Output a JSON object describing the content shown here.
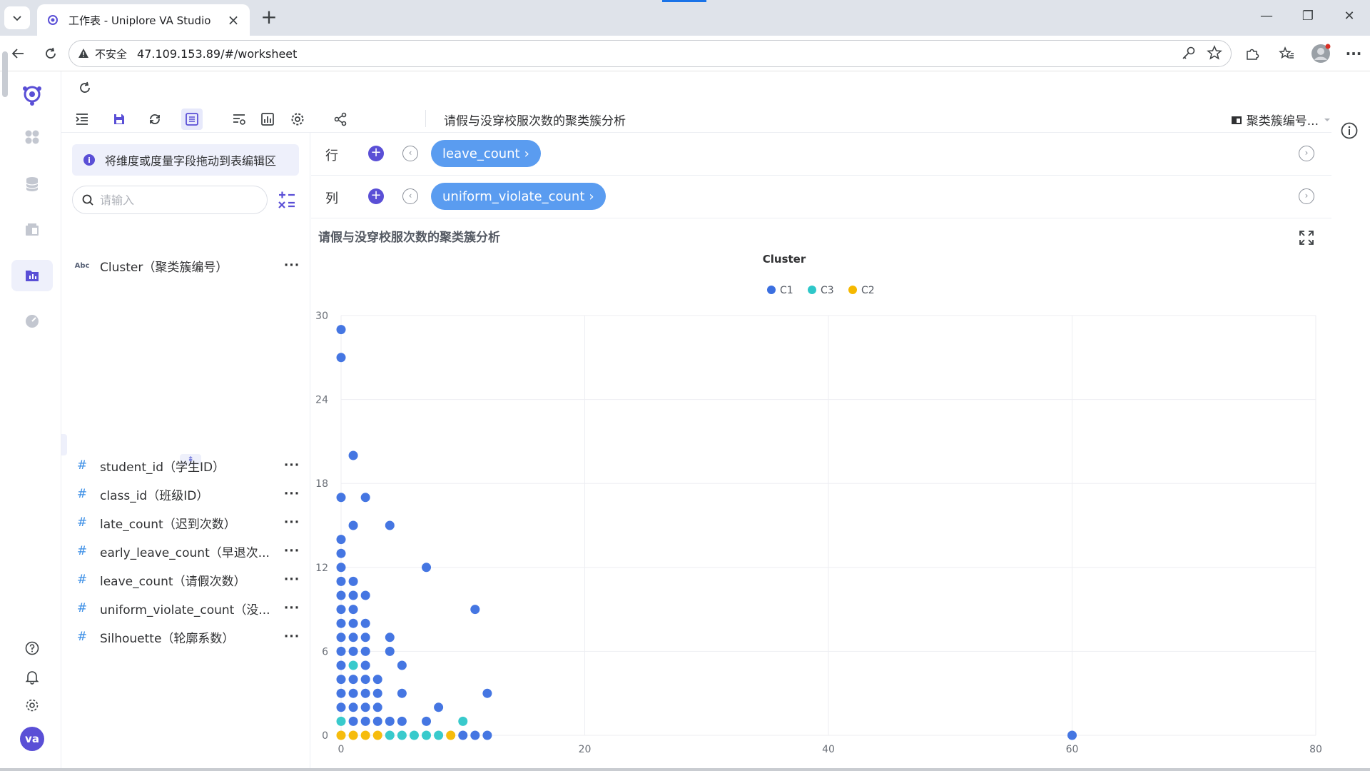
{
  "browser": {
    "tab_title": "工作表 - Uniplore VA Studio",
    "insecure_label": "不安全",
    "url": "47.109.153.89/#/worksheet"
  },
  "worksheet": {
    "title": "请假与没穿校服次数的聚类簇分析",
    "right_label": "聚类簇编号..."
  },
  "field_panel": {
    "hint": "将维度或度量字段拖动到表编辑区",
    "search_placeholder": "请输入",
    "dimension_icon": "Abc",
    "measure_icon": "#",
    "more_icon": "···",
    "dimensions": [
      {
        "label": "Cluster（聚类簇编号）"
      }
    ],
    "measures": [
      {
        "label": "student_id（学生ID）"
      },
      {
        "label": "class_id（班级ID）"
      },
      {
        "label": "late_count（迟到次数）"
      },
      {
        "label": "early_leave_count（早退次..."
      },
      {
        "label": "leave_count（请假次数）"
      },
      {
        "label": "uniform_violate_count（没..."
      },
      {
        "label": "Silhouette（轮廓系数）"
      }
    ]
  },
  "shelves": {
    "row_label": "行",
    "col_label": "列",
    "row_pill": "leave_count",
    "col_pill": "uniform_violate_count"
  },
  "colors": {
    "accent": "#5a4fd6",
    "pill": "#5a9cf0",
    "C1": "#3b6fe0",
    "C3": "#2ec7c9",
    "C2": "#f5b800"
  },
  "chart_data": {
    "type": "scatter",
    "title": "请假与没穿校服次数的聚类簇分析",
    "legend_title": "Cluster",
    "legend_position": "top-center",
    "xlim": [
      0,
      80
    ],
    "ylim": [
      0,
      30
    ],
    "x_ticks": [
      0,
      20,
      40,
      60,
      80
    ],
    "y_ticks": [
      0,
      6,
      12,
      18,
      24,
      30
    ],
    "grid": true,
    "series": [
      {
        "name": "C1",
        "color": "#3b6fe0",
        "points": [
          [
            0,
            29
          ],
          [
            0,
            27
          ],
          [
            1,
            20
          ],
          [
            0,
            17
          ],
          [
            2,
            17
          ],
          [
            1,
            15
          ],
          [
            4,
            15
          ],
          [
            0,
            14
          ],
          [
            0,
            13
          ],
          [
            0,
            12
          ],
          [
            7,
            12
          ],
          [
            0,
            11
          ],
          [
            1,
            11
          ],
          [
            0,
            10
          ],
          [
            1,
            10
          ],
          [
            2,
            10
          ],
          [
            0,
            9
          ],
          [
            1,
            9
          ],
          [
            11,
            9
          ],
          [
            0,
            8
          ],
          [
            1,
            8
          ],
          [
            2,
            8
          ],
          [
            0,
            7
          ],
          [
            1,
            7
          ],
          [
            2,
            7
          ],
          [
            4,
            7
          ],
          [
            0,
            6
          ],
          [
            1,
            6
          ],
          [
            2,
            6
          ],
          [
            4,
            6
          ],
          [
            0,
            5
          ],
          [
            2,
            5
          ],
          [
            5,
            5
          ],
          [
            0,
            4
          ],
          [
            1,
            4
          ],
          [
            2,
            4
          ],
          [
            3,
            4
          ],
          [
            0,
            3
          ],
          [
            1,
            3
          ],
          [
            2,
            3
          ],
          [
            3,
            3
          ],
          [
            5,
            3
          ],
          [
            12,
            3
          ],
          [
            0,
            2
          ],
          [
            1,
            2
          ],
          [
            2,
            2
          ],
          [
            3,
            2
          ],
          [
            8,
            2
          ],
          [
            1,
            1
          ],
          [
            2,
            1
          ],
          [
            3,
            1
          ],
          [
            4,
            1
          ],
          [
            5,
            1
          ],
          [
            7,
            1
          ],
          [
            10,
            0
          ],
          [
            11,
            0
          ],
          [
            12,
            0
          ],
          [
            60,
            0
          ]
        ]
      },
      {
        "name": "C3",
        "color": "#2ec7c9",
        "points": [
          [
            1,
            5
          ],
          [
            0,
            1
          ],
          [
            10,
            1
          ],
          [
            4,
            0
          ],
          [
            5,
            0
          ],
          [
            6,
            0
          ],
          [
            7,
            0
          ],
          [
            8,
            0
          ]
        ]
      },
      {
        "name": "C2",
        "color": "#f5b800",
        "points": [
          [
            0,
            0
          ],
          [
            1,
            0
          ],
          [
            2,
            0
          ],
          [
            3,
            0
          ],
          [
            9,
            0
          ]
        ]
      }
    ]
  }
}
